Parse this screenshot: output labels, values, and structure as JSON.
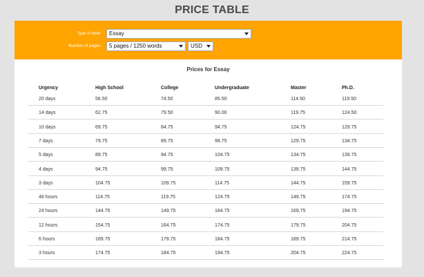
{
  "page_title": "PRICE TABLE",
  "form": {
    "type_of_work_label": "Type of work:",
    "type_of_work_value": "Essay",
    "number_of_pages_label": "Number of pages:",
    "number_of_pages_value": "5 pages / 1250 words",
    "currency_value": "USD"
  },
  "table": {
    "title": "Prices for Essay",
    "columns": [
      "Urgency",
      "High School",
      "College",
      "Undergraduate",
      "Master",
      "Ph.D."
    ],
    "rows": [
      [
        "20 days",
        "56.50",
        "74.50",
        "85.50",
        "114.50",
        "119.50"
      ],
      [
        "14 days",
        "62.75",
        "79.50",
        "90.00",
        "119.75",
        "124.50"
      ],
      [
        "10 days",
        "69.75",
        "84.75",
        "94.75",
        "124.75",
        "129.75"
      ],
      [
        "7 days",
        "79.75",
        "89.75",
        "99.75",
        "129.75",
        "134.75"
      ],
      [
        "5 days",
        "89.75",
        "94.75",
        "104.75",
        "134.75",
        "139.75"
      ],
      [
        "4 days",
        "94.75",
        "99.75",
        "109.75",
        "139.75",
        "144.75"
      ],
      [
        "3 days",
        "104.75",
        "109.75",
        "114.75",
        "144.75",
        "159.75"
      ],
      [
        "48 hours",
        "114.75",
        "119.75",
        "124.75",
        "149.75",
        "174.75"
      ],
      [
        "24 hours",
        "144.75",
        "149.75",
        "164.75",
        "169.75",
        "194.75"
      ],
      [
        "12 hours",
        "154.75",
        "164.75",
        "174.75",
        "179.75",
        "204.75"
      ],
      [
        "6 hours",
        "169.75",
        "179.75",
        "184.75",
        "189.75",
        "214.75"
      ],
      [
        "3 hours",
        "174.75",
        "184.75",
        "194.75",
        "204.75",
        "224.75"
      ]
    ]
  }
}
